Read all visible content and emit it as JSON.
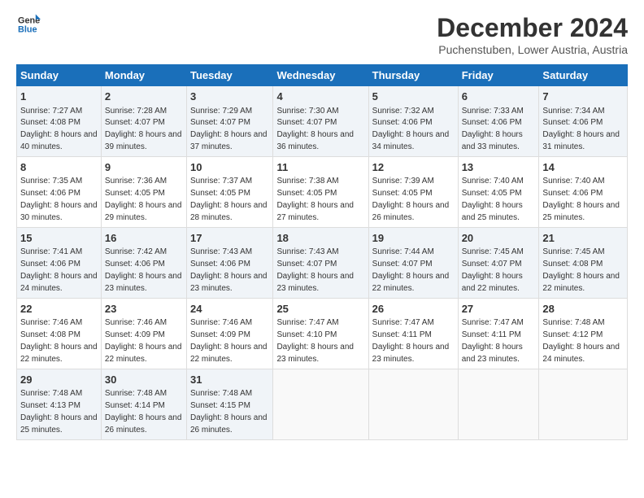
{
  "header": {
    "logo_line1": "General",
    "logo_line2": "Blue",
    "main_title": "December 2024",
    "subtitle": "Puchenstuben, Lower Austria, Austria"
  },
  "columns": [
    "Sunday",
    "Monday",
    "Tuesday",
    "Wednesday",
    "Thursday",
    "Friday",
    "Saturday"
  ],
  "rows": [
    [
      {
        "day": "1",
        "rise": "Sunrise: 7:27 AM",
        "set": "Sunset: 4:08 PM",
        "daylight": "Daylight: 8 hours and 40 minutes."
      },
      {
        "day": "2",
        "rise": "Sunrise: 7:28 AM",
        "set": "Sunset: 4:07 PM",
        "daylight": "Daylight: 8 hours and 39 minutes."
      },
      {
        "day": "3",
        "rise": "Sunrise: 7:29 AM",
        "set": "Sunset: 4:07 PM",
        "daylight": "Daylight: 8 hours and 37 minutes."
      },
      {
        "day": "4",
        "rise": "Sunrise: 7:30 AM",
        "set": "Sunset: 4:07 PM",
        "daylight": "Daylight: 8 hours and 36 minutes."
      },
      {
        "day": "5",
        "rise": "Sunrise: 7:32 AM",
        "set": "Sunset: 4:06 PM",
        "daylight": "Daylight: 8 hours and 34 minutes."
      },
      {
        "day": "6",
        "rise": "Sunrise: 7:33 AM",
        "set": "Sunset: 4:06 PM",
        "daylight": "Daylight: 8 hours and 33 minutes."
      },
      {
        "day": "7",
        "rise": "Sunrise: 7:34 AM",
        "set": "Sunset: 4:06 PM",
        "daylight": "Daylight: 8 hours and 31 minutes."
      }
    ],
    [
      {
        "day": "8",
        "rise": "Sunrise: 7:35 AM",
        "set": "Sunset: 4:06 PM",
        "daylight": "Daylight: 8 hours and 30 minutes."
      },
      {
        "day": "9",
        "rise": "Sunrise: 7:36 AM",
        "set": "Sunset: 4:05 PM",
        "daylight": "Daylight: 8 hours and 29 minutes."
      },
      {
        "day": "10",
        "rise": "Sunrise: 7:37 AM",
        "set": "Sunset: 4:05 PM",
        "daylight": "Daylight: 8 hours and 28 minutes."
      },
      {
        "day": "11",
        "rise": "Sunrise: 7:38 AM",
        "set": "Sunset: 4:05 PM",
        "daylight": "Daylight: 8 hours and 27 minutes."
      },
      {
        "day": "12",
        "rise": "Sunrise: 7:39 AM",
        "set": "Sunset: 4:05 PM",
        "daylight": "Daylight: 8 hours and 26 minutes."
      },
      {
        "day": "13",
        "rise": "Sunrise: 7:40 AM",
        "set": "Sunset: 4:05 PM",
        "daylight": "Daylight: 8 hours and 25 minutes."
      },
      {
        "day": "14",
        "rise": "Sunrise: 7:40 AM",
        "set": "Sunset: 4:06 PM",
        "daylight": "Daylight: 8 hours and 25 minutes."
      }
    ],
    [
      {
        "day": "15",
        "rise": "Sunrise: 7:41 AM",
        "set": "Sunset: 4:06 PM",
        "daylight": "Daylight: 8 hours and 24 minutes."
      },
      {
        "day": "16",
        "rise": "Sunrise: 7:42 AM",
        "set": "Sunset: 4:06 PM",
        "daylight": "Daylight: 8 hours and 23 minutes."
      },
      {
        "day": "17",
        "rise": "Sunrise: 7:43 AM",
        "set": "Sunset: 4:06 PM",
        "daylight": "Daylight: 8 hours and 23 minutes."
      },
      {
        "day": "18",
        "rise": "Sunrise: 7:43 AM",
        "set": "Sunset: 4:07 PM",
        "daylight": "Daylight: 8 hours and 23 minutes."
      },
      {
        "day": "19",
        "rise": "Sunrise: 7:44 AM",
        "set": "Sunset: 4:07 PM",
        "daylight": "Daylight: 8 hours and 22 minutes."
      },
      {
        "day": "20",
        "rise": "Sunrise: 7:45 AM",
        "set": "Sunset: 4:07 PM",
        "daylight": "Daylight: 8 hours and 22 minutes."
      },
      {
        "day": "21",
        "rise": "Sunrise: 7:45 AM",
        "set": "Sunset: 4:08 PM",
        "daylight": "Daylight: 8 hours and 22 minutes."
      }
    ],
    [
      {
        "day": "22",
        "rise": "Sunrise: 7:46 AM",
        "set": "Sunset: 4:08 PM",
        "daylight": "Daylight: 8 hours and 22 minutes."
      },
      {
        "day": "23",
        "rise": "Sunrise: 7:46 AM",
        "set": "Sunset: 4:09 PM",
        "daylight": "Daylight: 8 hours and 22 minutes."
      },
      {
        "day": "24",
        "rise": "Sunrise: 7:46 AM",
        "set": "Sunset: 4:09 PM",
        "daylight": "Daylight: 8 hours and 22 minutes."
      },
      {
        "day": "25",
        "rise": "Sunrise: 7:47 AM",
        "set": "Sunset: 4:10 PM",
        "daylight": "Daylight: 8 hours and 23 minutes."
      },
      {
        "day": "26",
        "rise": "Sunrise: 7:47 AM",
        "set": "Sunset: 4:11 PM",
        "daylight": "Daylight: 8 hours and 23 minutes."
      },
      {
        "day": "27",
        "rise": "Sunrise: 7:47 AM",
        "set": "Sunset: 4:11 PM",
        "daylight": "Daylight: 8 hours and 23 minutes."
      },
      {
        "day": "28",
        "rise": "Sunrise: 7:48 AM",
        "set": "Sunset: 4:12 PM",
        "daylight": "Daylight: 8 hours and 24 minutes."
      }
    ],
    [
      {
        "day": "29",
        "rise": "Sunrise: 7:48 AM",
        "set": "Sunset: 4:13 PM",
        "daylight": "Daylight: 8 hours and 25 minutes."
      },
      {
        "day": "30",
        "rise": "Sunrise: 7:48 AM",
        "set": "Sunset: 4:14 PM",
        "daylight": "Daylight: 8 hours and 26 minutes."
      },
      {
        "day": "31",
        "rise": "Sunrise: 7:48 AM",
        "set": "Sunset: 4:15 PM",
        "daylight": "Daylight: 8 hours and 26 minutes."
      },
      null,
      null,
      null,
      null
    ]
  ]
}
